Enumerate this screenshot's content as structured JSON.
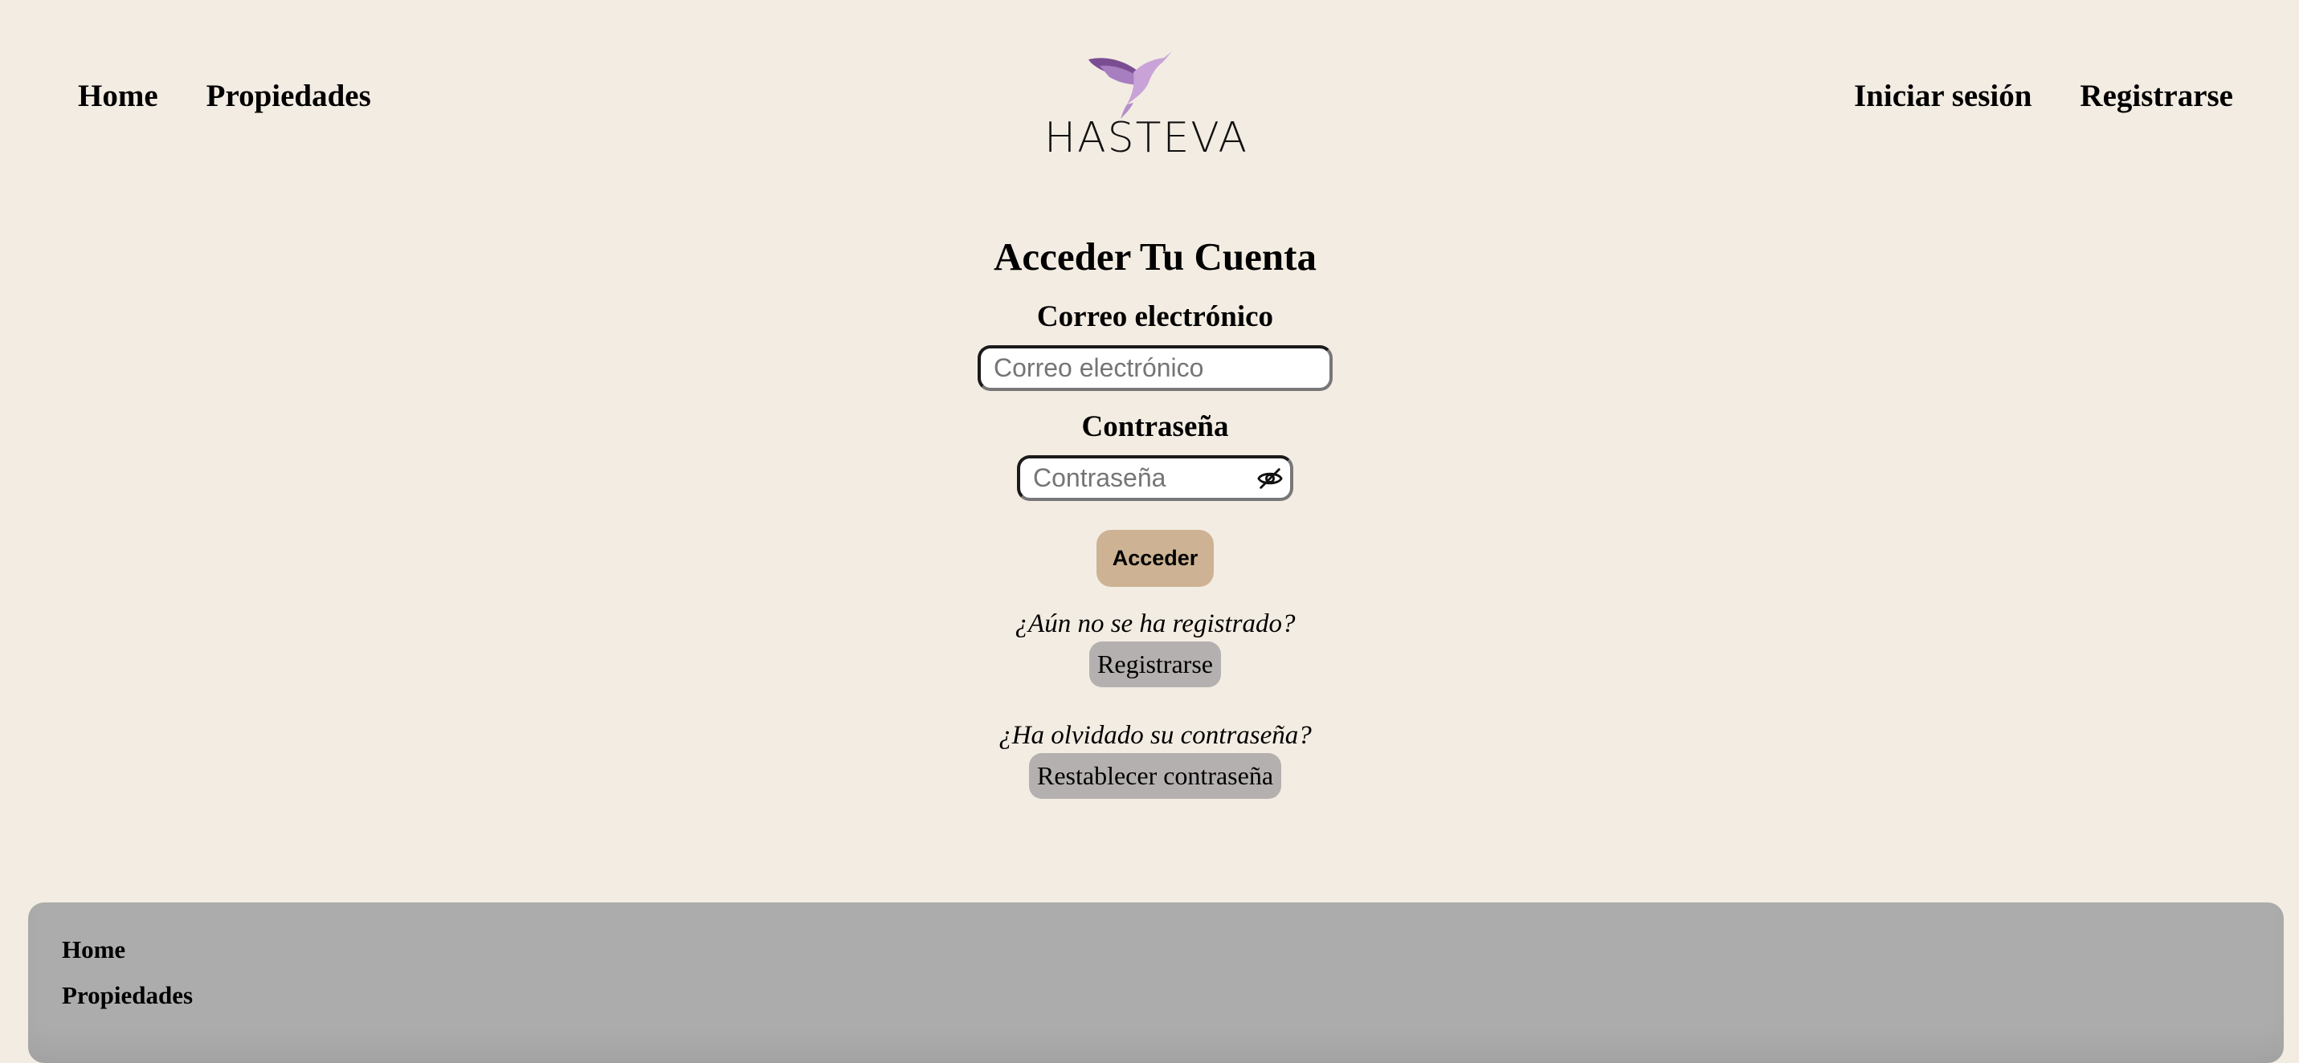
{
  "header": {
    "nav_left": [
      "Home",
      "Propiedades"
    ],
    "nav_right": [
      "Iniciar sesión",
      "Registrarse"
    ],
    "logo_text": "HASTEVA",
    "logo_icon": "hummingbird-icon"
  },
  "login": {
    "title": "Acceder Tu Cuenta",
    "email_label": "Correo electrónico",
    "email_placeholder": "Correo electrónico",
    "email_value": "",
    "password_label": "Contraseña",
    "password_placeholder": "Contraseña",
    "password_value": "",
    "password_toggle_icon": "eye-slash-icon",
    "submit_label": "Acceder",
    "register_question": "¿Aún no se ha registrado?",
    "register_label": "Registrarse",
    "forgot_question": "¿Ha olvidado su contraseña?",
    "reset_label": "Restablecer contraseña"
  },
  "footer": {
    "links": [
      "Home",
      "Propiedades"
    ]
  },
  "colors": {
    "background": "#f3ece2",
    "primary_button": "#cdb393",
    "secondary_button": "#b5b0b0",
    "footer": "#acacac",
    "logo_purple": "#8a5a9e"
  }
}
